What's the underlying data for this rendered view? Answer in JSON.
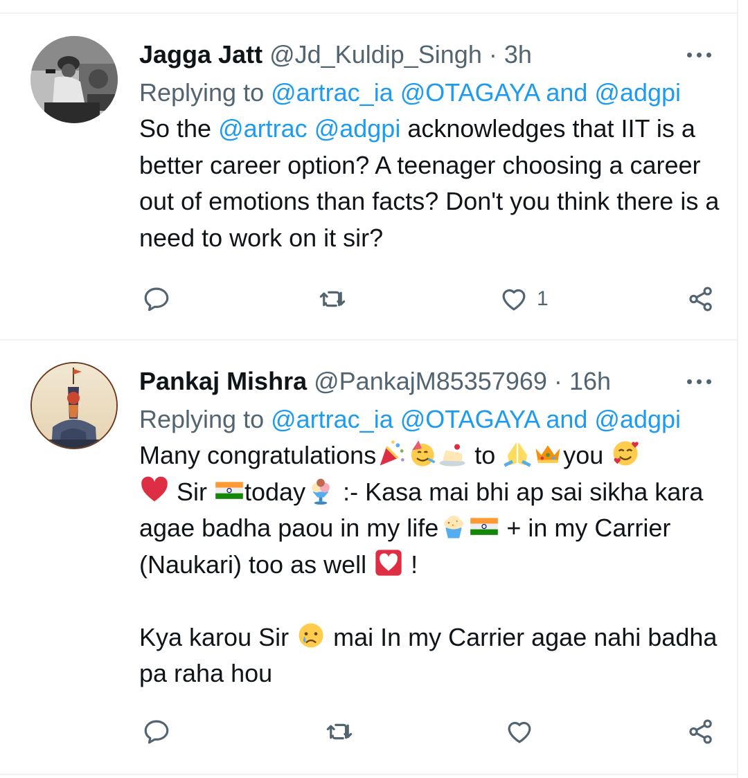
{
  "tweets": [
    {
      "name": "Jagga Jatt",
      "handle": "@Jd_Kuldip_Singh",
      "dot": "·",
      "time": "3h",
      "replying_prefix": "Replying to ",
      "replying_a": "@artrac_ia",
      "replying_b": "@OTAGAYA",
      "replying_and": " and ",
      "replying_c": "@adgpi",
      "body_plain_1": "So the ",
      "body_link_1": "@artrac",
      "body_space": " ",
      "body_link_2": "@adgpi",
      "body_plain_2": " acknowledges that IIT is a better career option? A teenager choosing a career out of emotions than facts? Don't you think there is a need to work on it sir?",
      "like_count": "1",
      "icons": {
        "reply": "reply-icon",
        "retweet": "retweet-icon",
        "like": "heart-icon",
        "share": "share-icon",
        "more": "more-icon"
      }
    },
    {
      "name": "Pankaj Mishra",
      "handle": "@PankajM85357969",
      "dot": "·",
      "time": "16h",
      "replying_prefix": "Replying to ",
      "replying_a": "@artrac_ia",
      "replying_b": "@OTAGAYA",
      "replying_and": " and ",
      "replying_c": "@adgpi",
      "seg1": "Many congratulations",
      "seg2": " to ",
      "seg3": "you ",
      "seg4": " Sir ",
      "seg5": "today",
      "seg6": " :- Kasa mai bhi ap sai sikha kara agae badha paou in my life",
      "seg7": " + in my Carrier (Naukari) too as well ",
      "seg8": " !",
      "seg9": "Kya karou Sir ",
      "seg10": " mai In my Carrier agae nahi badha pa raha hou",
      "like_count": "",
      "emojis": [
        "party-popper",
        "partying-face",
        "cake",
        "folded-hands",
        "crown",
        "smiling-face-with-hearts",
        "red-heart",
        "india-flag",
        "ice-cream",
        "cupcake",
        "india-flag",
        "heart-letter",
        "crying-face"
      ]
    }
  ],
  "colors": {
    "link": "#1d9bf0",
    "muted": "#536471",
    "text": "#0f1419",
    "divider": "#eff3f4"
  }
}
